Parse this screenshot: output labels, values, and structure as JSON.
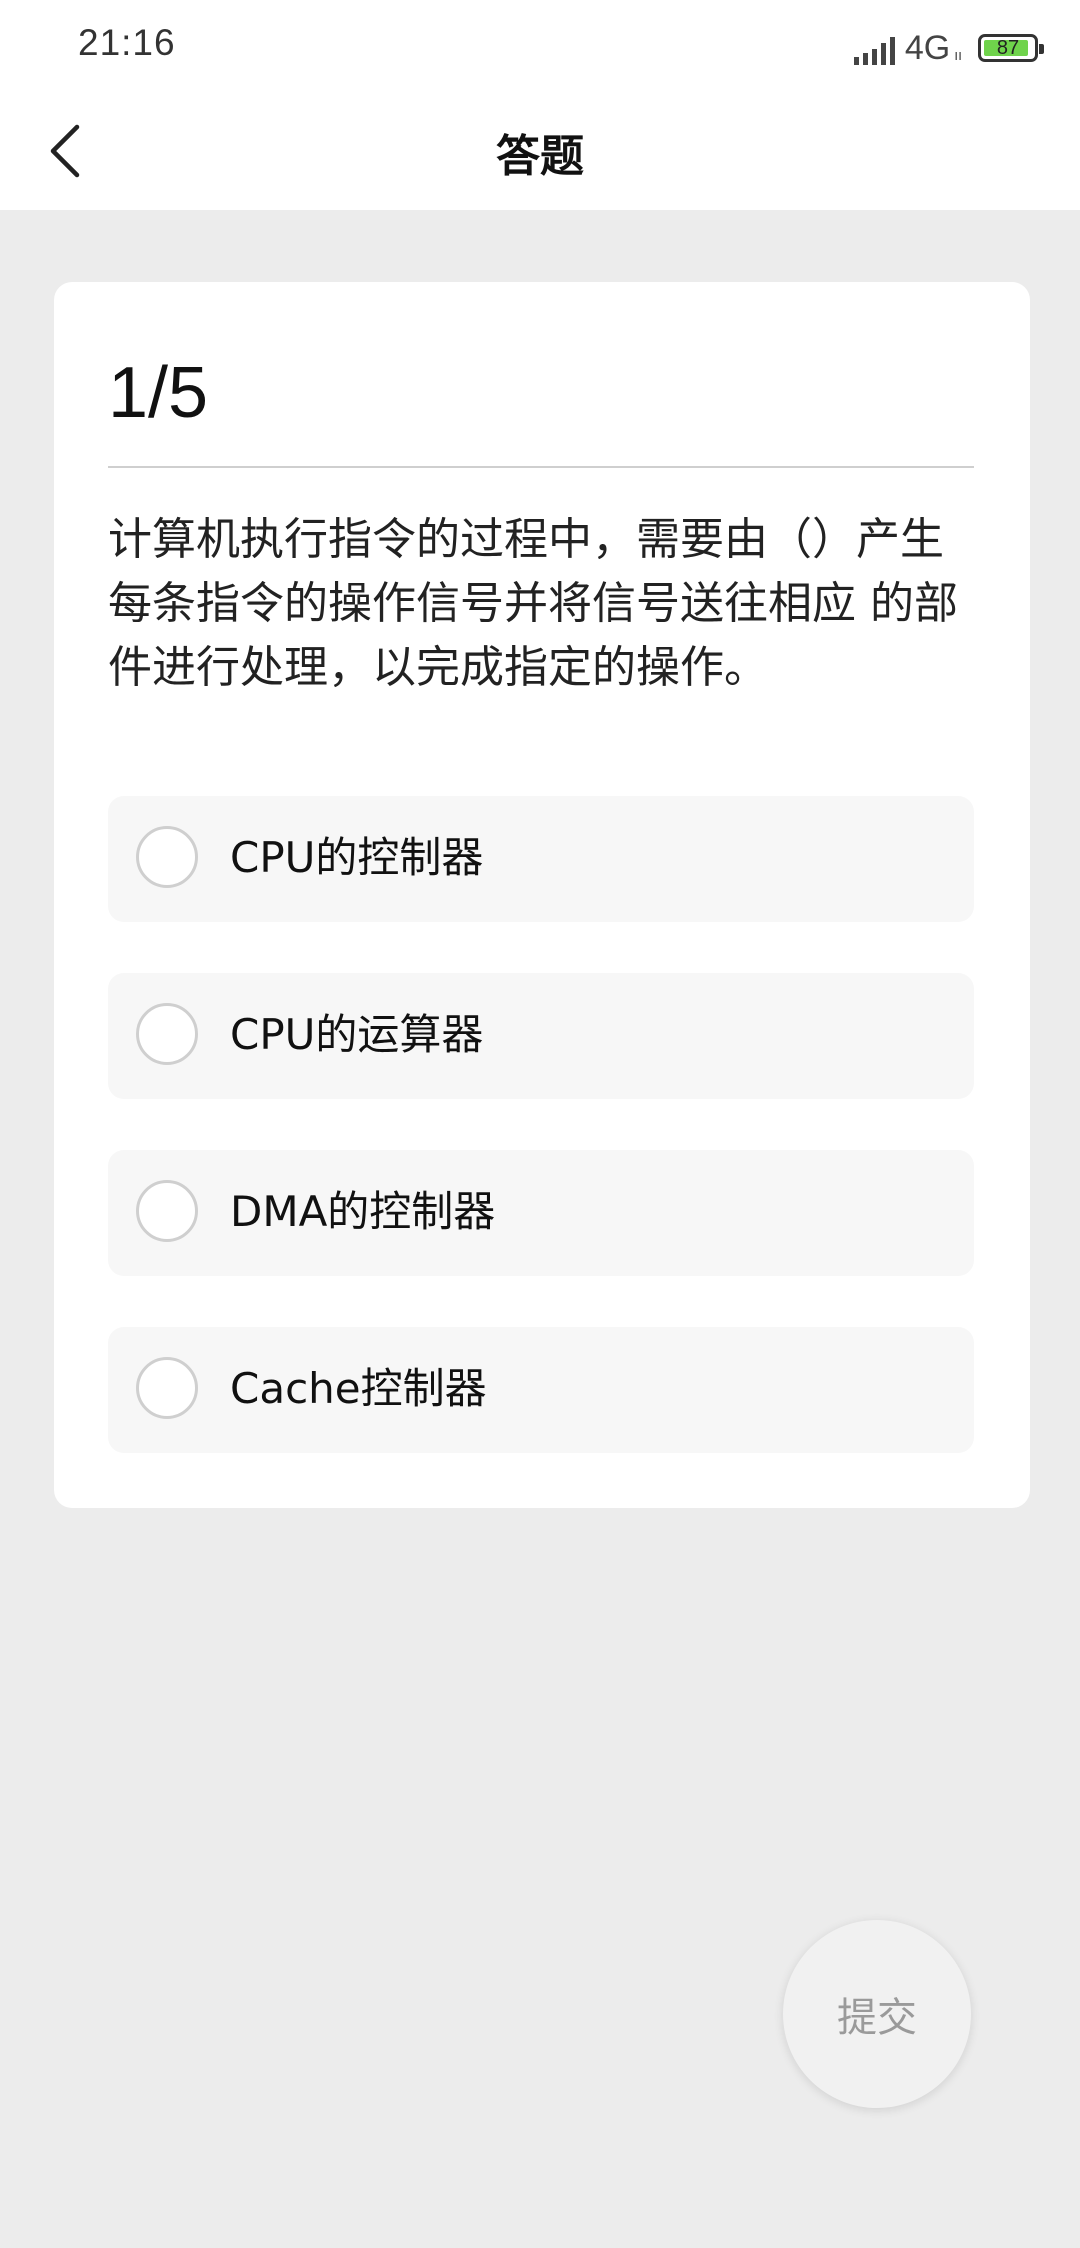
{
  "status": {
    "time": "21:16",
    "network": "4G",
    "network_sub": "ıı",
    "battery": "87"
  },
  "nav": {
    "title": "答题",
    "back_icon": "chevron-left-icon"
  },
  "quiz": {
    "index": "1/5",
    "question": "计算机执行指令的过程中，需要由（）产生每条指令的操作信号并将信号送往相应 的部件进行处理，以完成指定的操作。",
    "options": [
      "CPU的控制器",
      "CPU的运算器",
      "DMA的控制器",
      "Cache控制器"
    ]
  },
  "submit_label": "提交",
  "colors": {
    "background": "#ececec",
    "card": "#ffffff",
    "option_bg": "#f7f7f7",
    "battery_fill": "#6fd34b"
  }
}
